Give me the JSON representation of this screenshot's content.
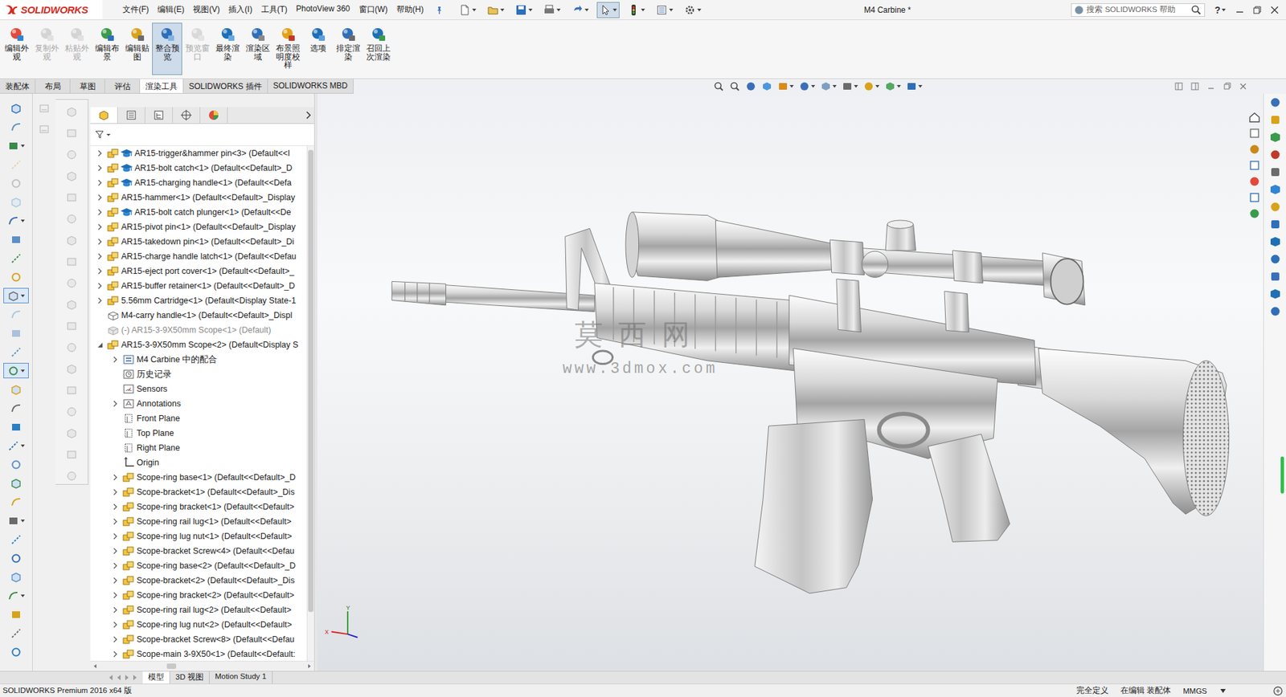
{
  "app": {
    "logo": "SOLIDWORKS",
    "title": "M4 Carbine *"
  },
  "menus": [
    "文件(F)",
    "编辑(E)",
    "视图(V)",
    "插入(I)",
    "工具(T)",
    "PhotoView 360",
    "窗口(W)",
    "帮助(H)"
  ],
  "quick_toolbar": [
    {
      "selected": false
    },
    {
      "selected": false
    },
    {
      "selected": false
    },
    {
      "selected": false
    },
    {
      "selected": false
    },
    {
      "selected": true
    },
    {
      "selected": false
    },
    {
      "selected": false
    },
    {
      "selected": false
    }
  ],
  "search": {
    "placeholder": "搜索 SOLIDWORKS 帮助"
  },
  "help_button": "?",
  "ribbon": [
    {
      "label": "编辑外观",
      "disabled": false,
      "selected": false
    },
    {
      "label": "复制外观",
      "disabled": true,
      "selected": false
    },
    {
      "label": "粘贴外观",
      "disabled": true,
      "selected": false
    },
    {
      "label": "编辑布景",
      "disabled": false,
      "selected": false
    },
    {
      "label": "编辑贴图",
      "disabled": false,
      "selected": false
    },
    {
      "label": "整合预览",
      "disabled": false,
      "selected": true
    },
    {
      "label": "预览窗口",
      "disabled": true,
      "selected": false
    },
    {
      "label": "最终渲染",
      "disabled": false,
      "selected": false
    },
    {
      "label": "渲染区域",
      "disabled": false,
      "selected": false
    },
    {
      "label": "布景照明度校样",
      "disabled": false,
      "selected": false
    },
    {
      "label": "选项",
      "disabled": false,
      "selected": false
    },
    {
      "label": "排定渲染",
      "disabled": false,
      "selected": false
    },
    {
      "label": "召回上次渲染",
      "disabled": false,
      "selected": false
    }
  ],
  "tabs": [
    {
      "label": "装配体",
      "selected": false
    },
    {
      "label": "布局",
      "selected": false
    },
    {
      "label": "草图",
      "selected": false
    },
    {
      "label": "评估",
      "selected": false
    },
    {
      "label": "渲染工具",
      "selected": true
    },
    {
      "label": "SOLIDWORKS 插件",
      "selected": false
    },
    {
      "label": "SOLIDWORKS MBD",
      "selected": false
    }
  ],
  "left_toolbar": [
    {
      "selected": false,
      "disabled": false
    },
    {
      "selected": false,
      "disabled": false
    },
    {
      "selected": false,
      "disabled": false
    },
    {
      "selected": false,
      "disabled": true
    },
    {
      "selected": false,
      "disabled": true
    },
    {
      "selected": false,
      "disabled": true
    },
    {
      "selected": false,
      "disabled": false
    },
    {
      "selected": false,
      "disabled": false
    },
    {
      "selected": false,
      "disabled": false
    },
    {
      "selected": false,
      "disabled": false
    },
    {
      "selected": true,
      "disabled": false
    },
    {
      "selected": false,
      "disabled": true
    },
    {
      "selected": false,
      "disabled": true
    },
    {
      "selected": false,
      "disabled": false
    },
    {
      "selected": true,
      "disabled": false
    },
    {
      "selected": false,
      "disabled": false
    },
    {
      "selected": false,
      "disabled": false
    },
    {
      "selected": false,
      "disabled": false
    },
    {
      "selected": false,
      "disabled": false
    },
    {
      "selected": false,
      "disabled": false
    },
    {
      "selected": false,
      "disabled": false
    },
    {
      "selected": false,
      "disabled": false
    },
    {
      "selected": false,
      "disabled": false
    },
    {
      "selected": false,
      "disabled": false
    },
    {
      "selected": false,
      "disabled": false
    },
    {
      "selected": false,
      "disabled": false
    },
    {
      "selected": false,
      "disabled": false
    },
    {
      "selected": false,
      "disabled": false
    },
    {
      "selected": false,
      "disabled": false
    },
    {
      "selected": false,
      "disabled": false
    }
  ],
  "mid_toolbar": [
    {
      "disabled": true
    },
    {
      "disabled": true
    }
  ],
  "second_toolbar": [
    {
      "disabled": true
    },
    {
      "disabled": true
    },
    {
      "disabled": true
    },
    {
      "disabled": true
    },
    {
      "disabled": true
    },
    {
      "disabled": true
    },
    {
      "disabled": true
    },
    {
      "disabled": true
    },
    {
      "disabled": true
    },
    {
      "disabled": true
    },
    {
      "disabled": true
    },
    {
      "disabled": true
    },
    {
      "disabled": true
    },
    {
      "disabled": true
    },
    {
      "disabled": true
    },
    {
      "disabled": true
    },
    {
      "disabled": true
    },
    {
      "disabled": true
    }
  ],
  "panel_tabs": [
    {
      "selected": true
    },
    {
      "selected": false
    },
    {
      "selected": false
    },
    {
      "selected": false
    },
    {
      "selected": false
    }
  ],
  "tree": [
    {
      "label": "AR15-trigger&hammer pin<3> (Default<<I",
      "kind": "assembly-mated",
      "expandable": true,
      "expanded": false,
      "suppressed": false
    },
    {
      "label": "AR15-bolt catch<1> (Default<<Default>_D",
      "kind": "assembly-mated",
      "expandable": true,
      "expanded": false,
      "suppressed": false
    },
    {
      "label": "AR15-charging handle<1> (Default<<Defa",
      "kind": "assembly-mated",
      "expandable": true,
      "expanded": false,
      "suppressed": false
    },
    {
      "label": "AR15-hammer<1> (Default<<Default>_Display",
      "kind": "assembly",
      "expandable": true,
      "expanded": false,
      "suppressed": false
    },
    {
      "label": "AR15-bolt catch plunger<1> (Default<<De",
      "kind": "assembly-mated",
      "expandable": true,
      "expanded": false,
      "suppressed": false
    },
    {
      "label": "AR15-pivot pin<1> (Default<<Default>_Display",
      "kind": "assembly",
      "expandable": true,
      "expanded": false,
      "suppressed": false
    },
    {
      "label": "AR15-takedown pin<1> (Default<<Default>_Di",
      "kind": "assembly",
      "expandable": true,
      "expanded": false,
      "suppressed": false
    },
    {
      "label": "AR15-charge handle latch<1> (Default<<Defau",
      "kind": "assembly",
      "expandable": true,
      "expanded": false,
      "suppressed": false
    },
    {
      "label": "AR15-eject port cover<1> (Default<<Default>_",
      "kind": "assembly",
      "expandable": true,
      "expanded": false,
      "suppressed": false
    },
    {
      "label": "AR15-buffer retainer<1> (Default<<Default>_D",
      "kind": "assembly",
      "expandable": true,
      "expanded": false,
      "suppressed": false
    },
    {
      "label": "5.56mm Cartridge<1> (Default<Display State-1",
      "kind": "assembly",
      "expandable": true,
      "expanded": false,
      "suppressed": false
    },
    {
      "label": "M4-carry handle<1> (Default<<Default>_Displ",
      "kind": "part-outline",
      "expandable": false,
      "expanded": false,
      "suppressed": false
    },
    {
      "label": "(-) AR15-3-9X50mm Scope<1> (Default)",
      "kind": "suppressed",
      "expandable": false,
      "expanded": false,
      "suppressed": true
    },
    {
      "label": "AR15-3-9X50mm Scope<2> (Default<Display S",
      "kind": "assembly",
      "expandable": true,
      "expanded": true,
      "suppressed": false,
      "children": [
        {
          "label": "M4 Carbine 中的配合",
          "kind": "mates",
          "expandable": true,
          "expanded": false,
          "suppressed": false
        },
        {
          "label": "历史记录",
          "kind": "history",
          "expandable": false,
          "expanded": false,
          "suppressed": false
        },
        {
          "label": "Sensors",
          "kind": "sensors",
          "expandable": false,
          "expanded": false,
          "suppressed": false
        },
        {
          "label": "Annotations",
          "kind": "annotations",
          "expandable": true,
          "expanded": false,
          "suppressed": false
        },
        {
          "label": "Front Plane",
          "kind": "plane",
          "expandable": false,
          "expanded": false,
          "suppressed": false
        },
        {
          "label": "Top Plane",
          "kind": "plane",
          "expandable": false,
          "expanded": false,
          "suppressed": false
        },
        {
          "label": "Right Plane",
          "kind": "plane",
          "expandable": false,
          "expanded": false,
          "suppressed": false
        },
        {
          "label": "Origin",
          "kind": "origin",
          "expandable": false,
          "expanded": false,
          "suppressed": false
        },
        {
          "label": "Scope-ring base<1> (Default<<Default>_D",
          "kind": "assembly",
          "expandable": true,
          "expanded": false,
          "suppressed": false
        },
        {
          "label": "Scope-bracket<1> (Default<<Default>_Dis",
          "kind": "assembly",
          "expandable": true,
          "expanded": false,
          "suppressed": false
        },
        {
          "label": "Scope-ring bracket<1> (Default<<Default>",
          "kind": "assembly",
          "expandable": true,
          "expanded": false,
          "suppressed": false
        },
        {
          "label": "Scope-ring rail lug<1> (Default<<Default>",
          "kind": "assembly",
          "expandable": true,
          "expanded": false,
          "suppressed": false
        },
        {
          "label": "Scope-ring lug nut<1> (Default<<Default>",
          "kind": "assembly",
          "expandable": true,
          "expanded": false,
          "suppressed": false
        },
        {
          "label": "Scope-bracket Screw<4> (Default<<Defau",
          "kind": "assembly",
          "expandable": true,
          "expanded": false,
          "suppressed": false
        },
        {
          "label": "Scope-ring base<2> (Default<<Default>_D",
          "kind": "assembly",
          "expandable": true,
          "expanded": false,
          "suppressed": false
        },
        {
          "label": "Scope-bracket<2> (Default<<Default>_Dis",
          "kind": "assembly",
          "expandable": true,
          "expanded": false,
          "suppressed": false
        },
        {
          "label": "Scope-ring bracket<2> (Default<<Default>",
          "kind": "assembly",
          "expandable": true,
          "expanded": false,
          "suppressed": false
        },
        {
          "label": "Scope-ring rail lug<2> (Default<<Default>",
          "kind": "assembly",
          "expandable": true,
          "expanded": false,
          "suppressed": false
        },
        {
          "label": "Scope-ring lug nut<2> (Default<<Default>",
          "kind": "assembly",
          "expandable": true,
          "expanded": false,
          "suppressed": false
        },
        {
          "label": "Scope-bracket Screw<8> (Default<<Defau",
          "kind": "assembly",
          "expandable": true,
          "expanded": false,
          "suppressed": false
        },
        {
          "label": "Scope-main 3-9X50<1> (Default<<Default:",
          "kind": "assembly",
          "expandable": true,
          "expanded": false,
          "suppressed": false
        }
      ]
    }
  ],
  "watermark": {
    "title": "莫西网",
    "url": "www.3dmox.com"
  },
  "triad": {
    "x": "X",
    "y": "Y"
  },
  "bottom_tabs": [
    {
      "label": "模型",
      "selected": true
    },
    {
      "label": "3D 视图",
      "selected": false
    },
    {
      "label": "Motion Study 1",
      "selected": false
    }
  ],
  "status_bar": {
    "product": "SOLIDWORKS Premium 2016 x64 版",
    "items": [
      "完全定义",
      "在编辑 装配体",
      "MMGS"
    ]
  }
}
